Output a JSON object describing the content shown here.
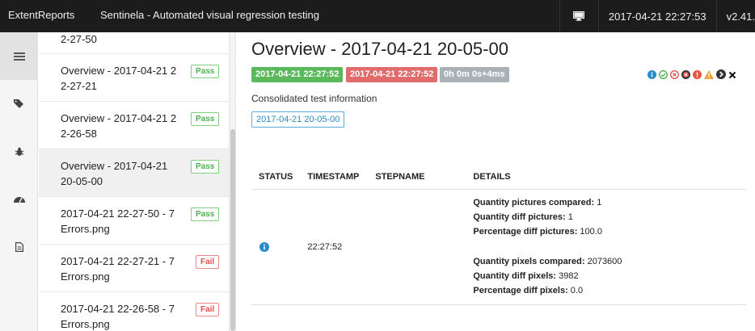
{
  "navbar": {
    "brand": "ExtentReports",
    "report_name": "Sentinela - Automated visual regression testing",
    "date": "2017-04-21 22:27:53",
    "version": "v2.41."
  },
  "rail": {
    "items": [
      {
        "icon": "list-icon",
        "active": true
      },
      {
        "icon": "tag-icon"
      },
      {
        "icon": "bug-icon"
      },
      {
        "icon": "dashboard-icon"
      },
      {
        "icon": "document-icon"
      }
    ]
  },
  "tests": [
    {
      "name": "2-27-50",
      "status": "",
      "active": false
    },
    {
      "name": "Overview - 2017-04-21 2 2-27-21",
      "status": "Pass",
      "active": false
    },
    {
      "name": "Overview - 2017-04-21 2 2-26-58",
      "status": "Pass",
      "active": false
    },
    {
      "name": "Overview - 2017-04-21 20-05-00",
      "status": "Pass",
      "active": true
    },
    {
      "name": "2017-04-21 22-27-50 - 7 Errors.png",
      "status": "Pass",
      "active": false
    },
    {
      "name": "2017-04-21 22-27-21 - 7 Errors.png",
      "status": "Fail",
      "active": false
    },
    {
      "name": "2017-04-21 22-26-58 - 7 Errors.png",
      "status": "Fail",
      "active": false
    }
  ],
  "detail": {
    "title": "Overview - 2017-04-21 20-05-00",
    "start_time": "2017-04-21 22:27:52",
    "end_time": "2017-04-21 22:27:52",
    "duration": "0h 0m 0s+4ms",
    "description": "Consolidated test information",
    "category": "2017-04-21 20-05-00",
    "status_icons": [
      "info-icon",
      "pass-icon",
      "fail-icon",
      "fatal-icon",
      "error-icon",
      "warning-icon",
      "skip-icon",
      "clear-filter-icon"
    ],
    "colors": {
      "pass": "#5cb85c",
      "fail": "#e06c6c",
      "info": "#2a8bc9",
      "warning": "#f0a030"
    }
  },
  "steps_table": {
    "headers": [
      "STATUS",
      "TIMESTAMP",
      "STEPNAME",
      "DETAILS"
    ],
    "rows": [
      {
        "status_icon": "info-icon",
        "timestamp": "22:27:52",
        "stepname": "",
        "details": [
          {
            "key": "Quantity pictures compared:",
            "value": " 1"
          },
          {
            "key": "Quantity diff pictures:",
            "value": " 1"
          },
          {
            "key": "Percentage diff pictures:",
            "value": " 100.0"
          },
          {
            "key": "Quantity pixels compared:",
            "value": " 2073600"
          },
          {
            "key": "Quantity diff pixels:",
            "value": " 3982"
          },
          {
            "key": "Percentage diff pixels:",
            "value": " 0.0"
          }
        ]
      }
    ]
  }
}
